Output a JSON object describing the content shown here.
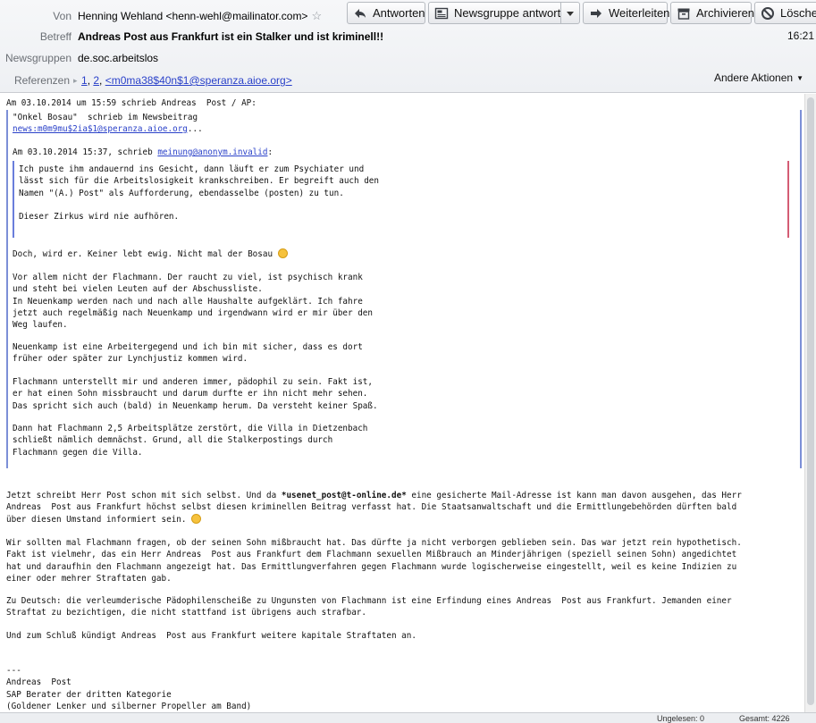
{
  "header": {
    "from_label": "Von",
    "from_value": "Henning Wehland <henn-wehl@mailinator.com>",
    "subject_label": "Betreff",
    "subject_value": "Andreas Post aus Frankfurt ist ein Stalker und ist kriminell!!",
    "newsgroups_label": "Newsgruppen",
    "newsgroups_value": "de.soc.arbeitslos",
    "references_label": "Referenzen",
    "references": [
      "1",
      "2",
      "<m0ma38$40n$1@speranza.aioe.org>"
    ],
    "time": "16:21",
    "other_actions": "Andere Aktionen"
  },
  "toolbar": {
    "reply": "Antworten",
    "reply_newsgroup": "Newsgruppe antworten",
    "forward": "Weiterleiten",
    "archive": "Archivieren",
    "delete": "Löschen"
  },
  "message": {
    "attrib_outer": "Am 03.10.2014 um 15:59 schrieb Andreas  Post / AP:",
    "q1_attrib": "\"Onkel Bosau\"  schrieb im Newsbeitrag",
    "q1_link": "news:m0m9mu$2ia$1@speranza.aioe.org",
    "q1_link_suffix": "...",
    "q1_attrib2_pre": "Am 03.10.2014 15:37, schrieb ",
    "q1_attrib2_link": "meinung@anonym.invalid",
    "q1_attrib2_post": ":",
    "q2_text": "Ich puste ihm andauernd ins Gesicht, dann läuft er zum Psychiater und\nlässt sich für die Arbeitslosigkeit krankschreiben. Er begreift auch den\nNamen \"(A.) Post\" als Aufforderung, ebendasselbe (posten) zu tun.\n\nDieser Zirkus wird nie aufhören.",
    "q1_p1": "Doch, wird er. Keiner lebt ewig. Nicht mal der Bosau ",
    "q1_p2": "Vor allem nicht der Flachmann. Der raucht zu viel, ist psychisch krank\nund steht bei vielen Leuten auf der Abschussliste.\nIn Neuenkamp werden nach und nach alle Haushalte aufgeklärt. Ich fahre\njetzt auch regelmäßig nach Neuenkamp und irgendwann wird er mir über den\nWeg laufen.",
    "q1_p3": "Neuenkamp ist eine Arbeitergegend und ich bin mit sicher, dass es dort\nfrüher oder später zur Lynchjustiz kommen wird.",
    "q1_p4": "Flachmann unterstellt mir und anderen immer, pädophil zu sein. Fakt ist,\ner hat einen Sohn missbraucht und darum durfte er ihn nicht mehr sehen.\nDas spricht sich auch (bald) in Neuenkamp herum. Da versteht keiner Spaß.",
    "q1_p5": "Dann hat Flachmann 2,5 Arbeitsplätze zerstört, die Villa in Dietzenbach\nschließt nämlich demnächst. Grund, all die Stalkerpostings durch\nFlachmann gegen die Villa.",
    "p1_a": "Jetzt schreibt Herr Post schon mit sich selbst. Und da ",
    "p1_bold": "*usenet_post@t-online.de*",
    "p1_b": " eine gesicherte Mail-Adresse ist kann man davon ausgehen, das Herr\nAndreas  Post aus Frankfurt höchst selbst diesen kriminellen Beitrag verfasst hat. Die Staatsanwaltschaft und die Ermittlungebehörden dürften bald\nüber diesen Umstand informiert sein. ",
    "p2": "Wir sollten mal Flachmann fragen, ob der seinen Sohn mißbraucht hat. Das dürfte ja nicht verborgen geblieben sein. Das war jetzt rein hypothetisch.\nFakt ist vielmehr, das ein Herr Andreas  Post aus Frankfurt dem Flachmann sexuellen Mißbrauch an Minderjährigen (speziell seinen Sohn) angedichtet\nhat und daraufhin den Flachmann angezeigt hat. Das Ermittlungverfahren gegen Flachmann wurde logischerweise eingestellt, weil es keine Indizien zu\neiner oder mehrer Straftaten gab.",
    "p3": "Zu Deutsch: die verleumderische Pädophilenscheiße zu Ungunsten von Flachmann ist eine Erfindung eines Andreas  Post aus Frankfurt. Jemanden einer\nStraftat zu bezichtigen, die nicht stattfand ist übrigens auch strafbar.",
    "p4": "Und zum Schluß kündigt Andreas  Post aus Frankfurt weitere kapitale Straftaten an.",
    "sig": "---\nAndreas  Post\nSAP Berater der dritten Kategorie\n(Goldener Lenker und silberner Propeller am Band)"
  },
  "statusbar": {
    "left": "Ungelesen: 0",
    "right": "Gesamt: 4226"
  }
}
